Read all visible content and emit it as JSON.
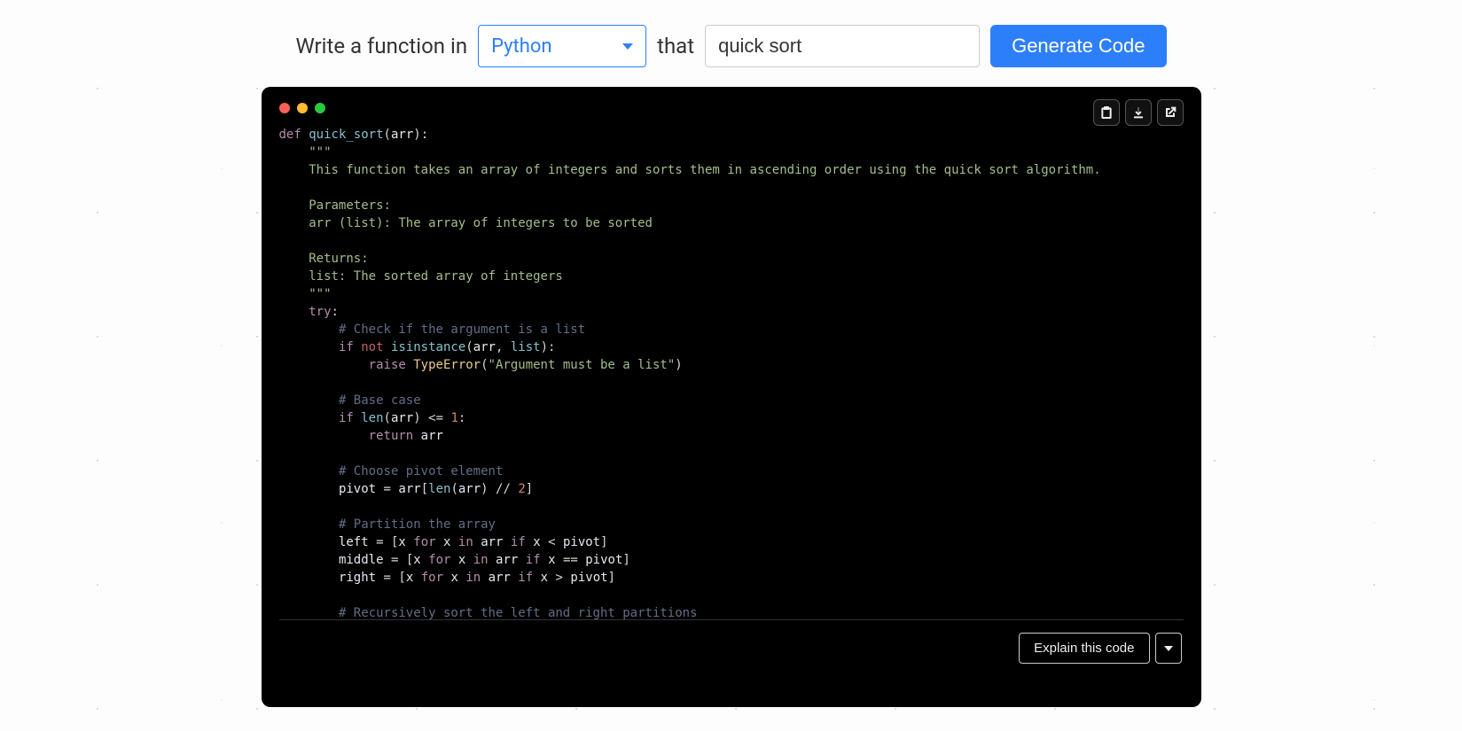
{
  "prompt": {
    "prefix": "Write a function in",
    "middle": "that",
    "language": "Python",
    "task_value": "quick sort",
    "generate_label": "Generate Code"
  },
  "code": {
    "lines": [
      [
        [
          "kw",
          "def"
        ],
        [
          "sp",
          " "
        ],
        [
          "fn",
          "quick_sort"
        ],
        [
          "punc",
          "("
        ],
        [
          "id",
          "arr"
        ],
        [
          "punc",
          ")"
        ],
        [
          "punc",
          ":"
        ]
      ],
      [
        [
          "sp",
          "    "
        ],
        [
          "str",
          "\"\"\""
        ]
      ],
      [
        [
          "sp",
          "    "
        ],
        [
          "str",
          "This function takes an array of integers and sorts them in ascending order using the quick sort algorithm."
        ]
      ],
      [],
      [
        [
          "sp",
          "    "
        ],
        [
          "str",
          "Parameters:"
        ]
      ],
      [
        [
          "sp",
          "    "
        ],
        [
          "str",
          "arr (list): The array of integers to be sorted"
        ]
      ],
      [],
      [
        [
          "sp",
          "    "
        ],
        [
          "str",
          "Returns:"
        ]
      ],
      [
        [
          "sp",
          "    "
        ],
        [
          "str",
          "list: The sorted array of integers"
        ]
      ],
      [
        [
          "sp",
          "    "
        ],
        [
          "str",
          "\"\"\""
        ]
      ],
      [
        [
          "sp",
          "    "
        ],
        [
          "kw",
          "try"
        ],
        [
          "punc",
          ":"
        ]
      ],
      [
        [
          "sp",
          "        "
        ],
        [
          "com",
          "# Check if the argument is a list"
        ]
      ],
      [
        [
          "sp",
          "        "
        ],
        [
          "kw",
          "if"
        ],
        [
          "sp",
          " "
        ],
        [
          "not",
          "not"
        ],
        [
          "sp",
          " "
        ],
        [
          "builtin",
          "isinstance"
        ],
        [
          "punc",
          "("
        ],
        [
          "id",
          "arr"
        ],
        [
          "punc",
          ","
        ],
        [
          "sp",
          " "
        ],
        [
          "builtin",
          "list"
        ],
        [
          "punc",
          ")"
        ],
        [
          "punc",
          ":"
        ]
      ],
      [
        [
          "sp",
          "            "
        ],
        [
          "kw",
          "raise"
        ],
        [
          "sp",
          " "
        ],
        [
          "type",
          "TypeError"
        ],
        [
          "punc",
          "("
        ],
        [
          "str",
          "\"Argument must be a list\""
        ],
        [
          "punc",
          ")"
        ]
      ],
      [],
      [
        [
          "sp",
          "        "
        ],
        [
          "com",
          "# Base case"
        ]
      ],
      [
        [
          "sp",
          "        "
        ],
        [
          "kw",
          "if"
        ],
        [
          "sp",
          " "
        ],
        [
          "builtin",
          "len"
        ],
        [
          "punc",
          "("
        ],
        [
          "id",
          "arr"
        ],
        [
          "punc",
          ")"
        ],
        [
          "sp",
          " "
        ],
        [
          "op",
          "<="
        ],
        [
          "sp",
          " "
        ],
        [
          "num",
          "1"
        ],
        [
          "punc",
          ":"
        ]
      ],
      [
        [
          "sp",
          "            "
        ],
        [
          "kw",
          "return"
        ],
        [
          "sp",
          " "
        ],
        [
          "id",
          "arr"
        ]
      ],
      [],
      [
        [
          "sp",
          "        "
        ],
        [
          "com",
          "# Choose pivot element"
        ]
      ],
      [
        [
          "sp",
          "        "
        ],
        [
          "id",
          "pivot"
        ],
        [
          "sp",
          " "
        ],
        [
          "op",
          "="
        ],
        [
          "sp",
          " "
        ],
        [
          "id",
          "arr"
        ],
        [
          "punc",
          "["
        ],
        [
          "builtin",
          "len"
        ],
        [
          "punc",
          "("
        ],
        [
          "id",
          "arr"
        ],
        [
          "punc",
          ")"
        ],
        [
          "sp",
          " "
        ],
        [
          "op",
          "//"
        ],
        [
          "sp",
          " "
        ],
        [
          "num",
          "2"
        ],
        [
          "punc",
          "]"
        ]
      ],
      [],
      [
        [
          "sp",
          "        "
        ],
        [
          "com",
          "# Partition the array"
        ]
      ],
      [
        [
          "sp",
          "        "
        ],
        [
          "id",
          "left"
        ],
        [
          "sp",
          " "
        ],
        [
          "op",
          "="
        ],
        [
          "sp",
          " "
        ],
        [
          "punc",
          "["
        ],
        [
          "id",
          "x"
        ],
        [
          "sp",
          " "
        ],
        [
          "kw",
          "for"
        ],
        [
          "sp",
          " "
        ],
        [
          "id",
          "x"
        ],
        [
          "sp",
          " "
        ],
        [
          "kw",
          "in"
        ],
        [
          "sp",
          " "
        ],
        [
          "id",
          "arr"
        ],
        [
          "sp",
          " "
        ],
        [
          "kw",
          "if"
        ],
        [
          "sp",
          " "
        ],
        [
          "id",
          "x"
        ],
        [
          "sp",
          " "
        ],
        [
          "op",
          "<"
        ],
        [
          "sp",
          " "
        ],
        [
          "id",
          "pivot"
        ],
        [
          "punc",
          "]"
        ]
      ],
      [
        [
          "sp",
          "        "
        ],
        [
          "id",
          "middle"
        ],
        [
          "sp",
          " "
        ],
        [
          "op",
          "="
        ],
        [
          "sp",
          " "
        ],
        [
          "punc",
          "["
        ],
        [
          "id",
          "x"
        ],
        [
          "sp",
          " "
        ],
        [
          "kw",
          "for"
        ],
        [
          "sp",
          " "
        ],
        [
          "id",
          "x"
        ],
        [
          "sp",
          " "
        ],
        [
          "kw",
          "in"
        ],
        [
          "sp",
          " "
        ],
        [
          "id",
          "arr"
        ],
        [
          "sp",
          " "
        ],
        [
          "kw",
          "if"
        ],
        [
          "sp",
          " "
        ],
        [
          "id",
          "x"
        ],
        [
          "sp",
          " "
        ],
        [
          "op",
          "=="
        ],
        [
          "sp",
          " "
        ],
        [
          "id",
          "pivot"
        ],
        [
          "punc",
          "]"
        ]
      ],
      [
        [
          "sp",
          "        "
        ],
        [
          "id",
          "right"
        ],
        [
          "sp",
          " "
        ],
        [
          "op",
          "="
        ],
        [
          "sp",
          " "
        ],
        [
          "punc",
          "["
        ],
        [
          "id",
          "x"
        ],
        [
          "sp",
          " "
        ],
        [
          "kw",
          "for"
        ],
        [
          "sp",
          " "
        ],
        [
          "id",
          "x"
        ],
        [
          "sp",
          " "
        ],
        [
          "kw",
          "in"
        ],
        [
          "sp",
          " "
        ],
        [
          "id",
          "arr"
        ],
        [
          "sp",
          " "
        ],
        [
          "kw",
          "if"
        ],
        [
          "sp",
          " "
        ],
        [
          "id",
          "x"
        ],
        [
          "sp",
          " "
        ],
        [
          "op",
          ">"
        ],
        [
          "sp",
          " "
        ],
        [
          "id",
          "pivot"
        ],
        [
          "punc",
          "]"
        ]
      ],
      [],
      [
        [
          "sp",
          "        "
        ],
        [
          "com",
          "# Recursively sort the left and right partitions"
        ]
      ]
    ]
  },
  "footer": {
    "explain_label": "Explain this code"
  }
}
